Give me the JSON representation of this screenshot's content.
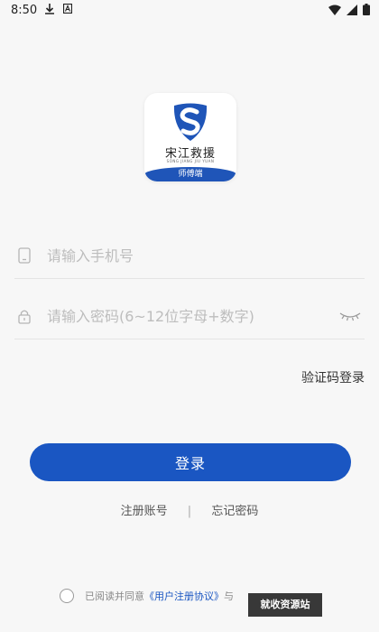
{
  "status_bar": {
    "time": "8:50"
  },
  "logo": {
    "title": "宋江救援",
    "pinyin": "SONG JIANG JIU YUAN",
    "band": "师傅端"
  },
  "form": {
    "phone_placeholder": "请输入手机号",
    "password_placeholder": "请输入密码(6~12位字母+数字)",
    "sms_login": "验证码登录",
    "login_button": "登录"
  },
  "links": {
    "register": "注册账号",
    "separator": "|",
    "forgot": "忘记密码"
  },
  "agreement": {
    "prefix": "已阅读并同意",
    "link": "《用户注册协议》",
    "suffix": "与"
  },
  "watermark": "就收资源站",
  "colors": {
    "accent": "#1a56c2",
    "background": "#f7f7f7"
  },
  "icons": [
    "download-icon",
    "a-icon",
    "wifi-icon",
    "signal-icon",
    "battery-icon",
    "phone-icon",
    "lock-icon",
    "eye-closed-icon",
    "shield-logo-icon"
  ]
}
